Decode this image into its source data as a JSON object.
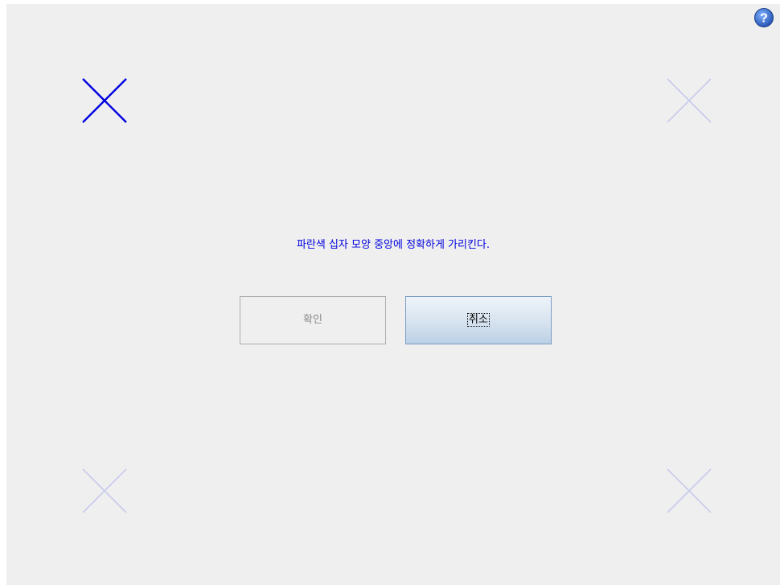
{
  "help": {
    "icon": "help-icon",
    "glyph": "?",
    "color": "#2b5fbf"
  },
  "targets": {
    "active_color": "#0000e0",
    "inactive_color": "#c9cdec",
    "items": [
      {
        "name": "top-left",
        "state": "active",
        "icon": "cross-icon"
      },
      {
        "name": "top-right",
        "state": "inactive",
        "icon": "cross-icon"
      },
      {
        "name": "bottom-left",
        "state": "inactive",
        "icon": "cross-icon"
      },
      {
        "name": "bottom-right",
        "state": "inactive",
        "icon": "cross-icon"
      }
    ]
  },
  "instruction": {
    "text": "파란색 십자 모양 중앙에 정확하게 가리킨다.",
    "color": "#0000e0"
  },
  "buttons": {
    "ok": {
      "label": "확인",
      "enabled": false
    },
    "cancel": {
      "label": "취소",
      "enabled": true,
      "focused": true
    }
  }
}
